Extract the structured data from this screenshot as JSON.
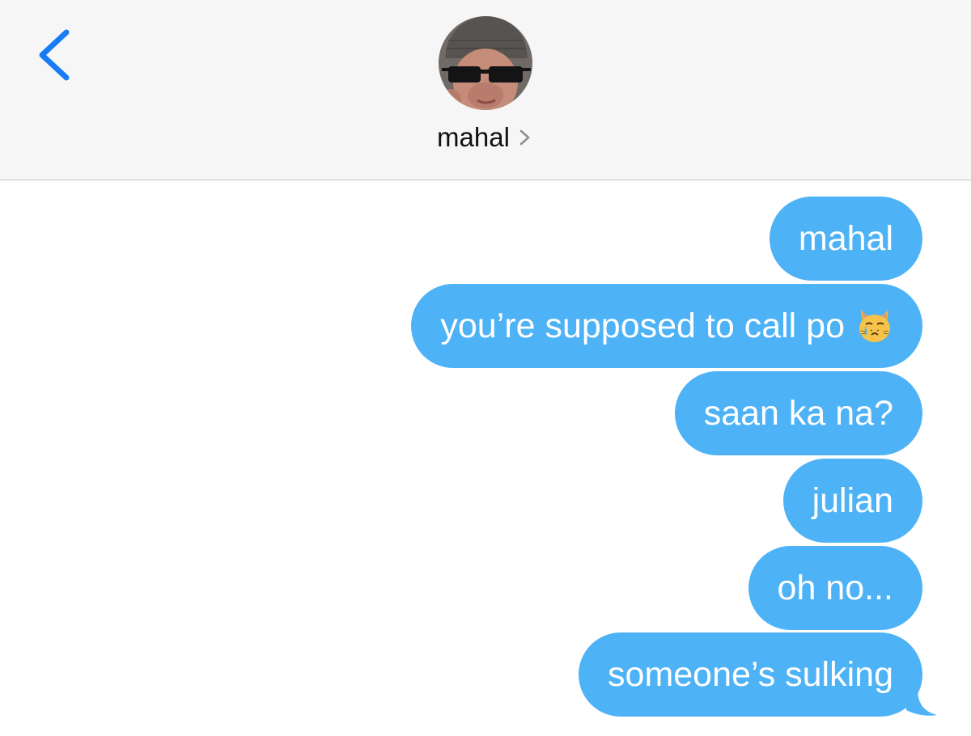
{
  "header": {
    "contact_name": "mahal",
    "back_icon": "chevron-left-icon",
    "details_icon": "chevron-right-icon",
    "accent_color": "#1a7cf5"
  },
  "messages": [
    {
      "direction": "outgoing",
      "text": "mahal"
    },
    {
      "direction": "outgoing",
      "text": "you’re supposed to call po",
      "emoji": "crying-cat-face"
    },
    {
      "direction": "outgoing",
      "text": "saan ka na?"
    },
    {
      "direction": "outgoing",
      "text": "julian"
    },
    {
      "direction": "outgoing",
      "text": "oh no..."
    },
    {
      "direction": "outgoing",
      "text": "someone’s sulking"
    }
  ],
  "colors": {
    "bubble": "#4eb2f6",
    "bubble_text": "#ffffff",
    "header_bg": "#f6f6f7"
  }
}
